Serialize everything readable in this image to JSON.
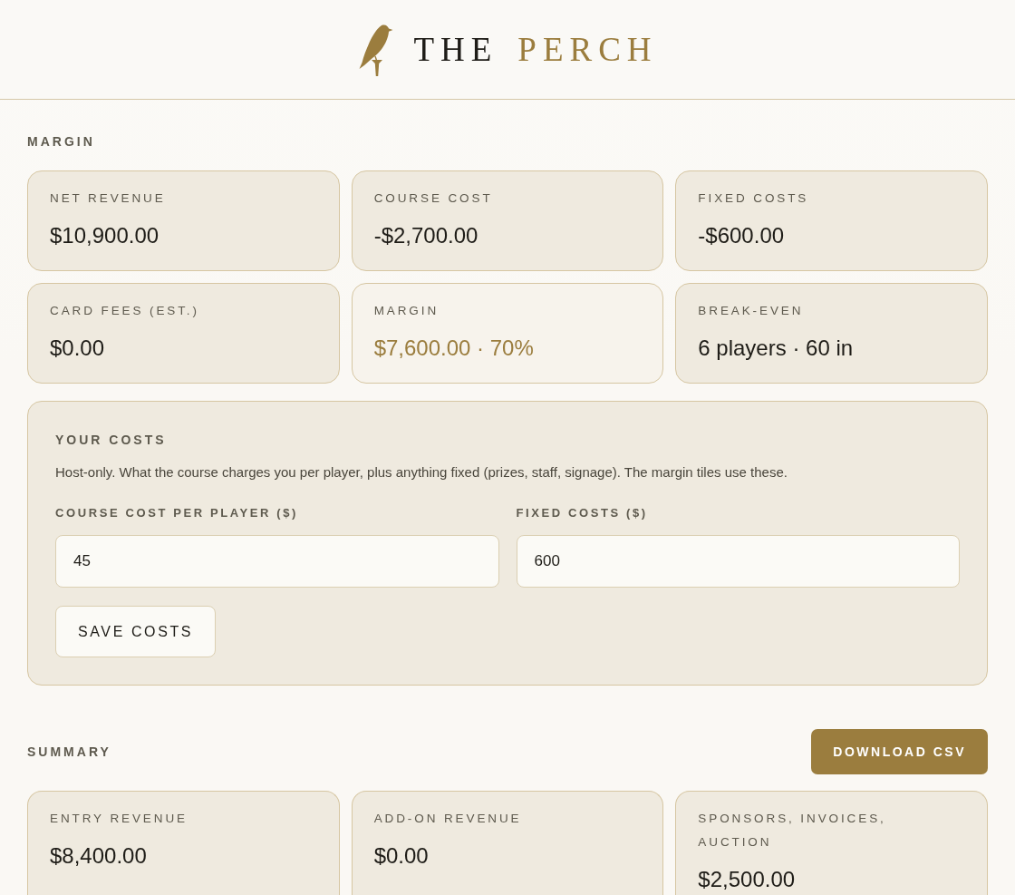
{
  "header": {
    "brand": [
      {
        "text": "THE",
        "accent": false
      },
      {
        "text": "PERCH",
        "accent": true
      }
    ]
  },
  "margin": {
    "title": "MARGIN",
    "tiles": [
      {
        "label": "NET REVENUE",
        "value": "$10,900.00",
        "highlight": false
      },
      {
        "label": "COURSE COST",
        "value": "-$2,700.00",
        "highlight": false
      },
      {
        "label": "FIXED COSTS",
        "value": "-$600.00",
        "highlight": false
      },
      {
        "label": "CARD FEES (EST.)",
        "value": "$0.00",
        "highlight": false
      },
      {
        "label": "MARGIN",
        "value": "$7,600.00 · 70%",
        "highlight": true
      },
      {
        "label": "BREAK-EVEN",
        "value": "6 players · 60 in",
        "highlight": false
      }
    ]
  },
  "costs": {
    "title": "YOUR COSTS",
    "description": "Host-only. What the course charges you per player, plus anything fixed (prizes, staff, signage). The margin tiles use these.",
    "fields": [
      {
        "label": "COURSE COST PER PLAYER ($)",
        "value": "45"
      },
      {
        "label": "FIXED COSTS ($)",
        "value": "600"
      }
    ],
    "save_button": "SAVE COSTS"
  },
  "summary": {
    "title": "SUMMARY",
    "download_button": "DOWNLOAD CSV",
    "tiles": [
      {
        "label": "ENTRY REVENUE",
        "value": "$8,400.00",
        "highlight": false
      },
      {
        "label": "ADD-ON REVENUE",
        "value": "$0.00",
        "highlight": false
      },
      {
        "label": "SPONSORS, INVOICES, AUCTION",
        "value": "$2,500.00",
        "highlight": false
      }
    ]
  }
}
